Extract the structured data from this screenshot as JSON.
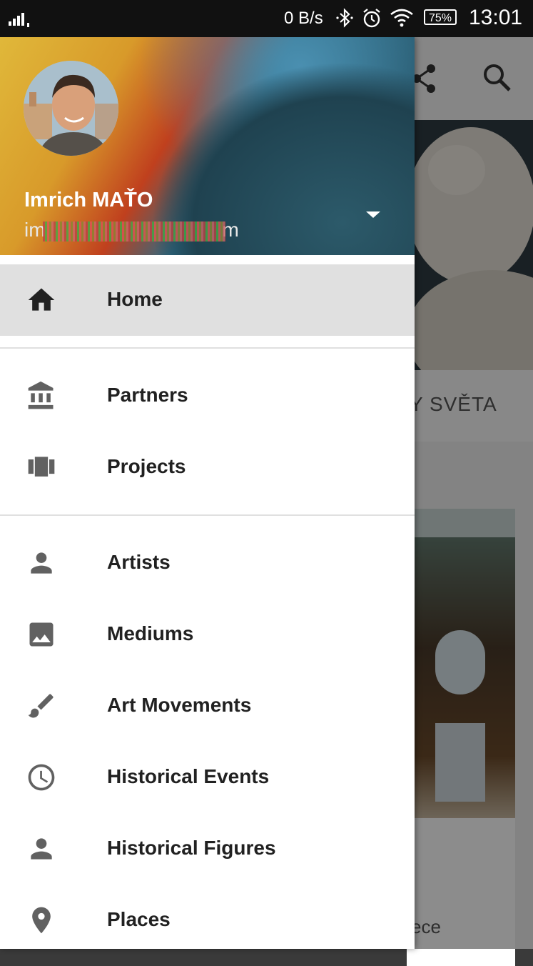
{
  "status_bar": {
    "network_speed": "0 B/s",
    "battery": "75%",
    "time": "13:01"
  },
  "background_app": {
    "tab_label": "Y SVĚTA",
    "card_text": "ece"
  },
  "drawer": {
    "user": {
      "name": "Imrich MAŤO",
      "email_prefix": "im",
      "email_suffix": "m"
    },
    "sections": [
      [
        {
          "label": "Home",
          "icon": "home-icon",
          "active": true
        }
      ],
      [
        {
          "label": "Partners",
          "icon": "bank-icon"
        },
        {
          "label": "Projects",
          "icon": "view-carousel-icon"
        }
      ],
      [
        {
          "label": "Artists",
          "icon": "person-icon"
        },
        {
          "label": "Mediums",
          "icon": "image-icon"
        },
        {
          "label": "Art Movements",
          "icon": "brush-icon"
        },
        {
          "label": "Historical Events",
          "icon": "clock-icon"
        },
        {
          "label": "Historical Figures",
          "icon": "person-icon"
        },
        {
          "label": "Places",
          "icon": "place-icon"
        }
      ]
    ]
  },
  "colors": {
    "active_item_bg": "#e0e0e0",
    "icon": "#616161",
    "text": "#212121"
  }
}
